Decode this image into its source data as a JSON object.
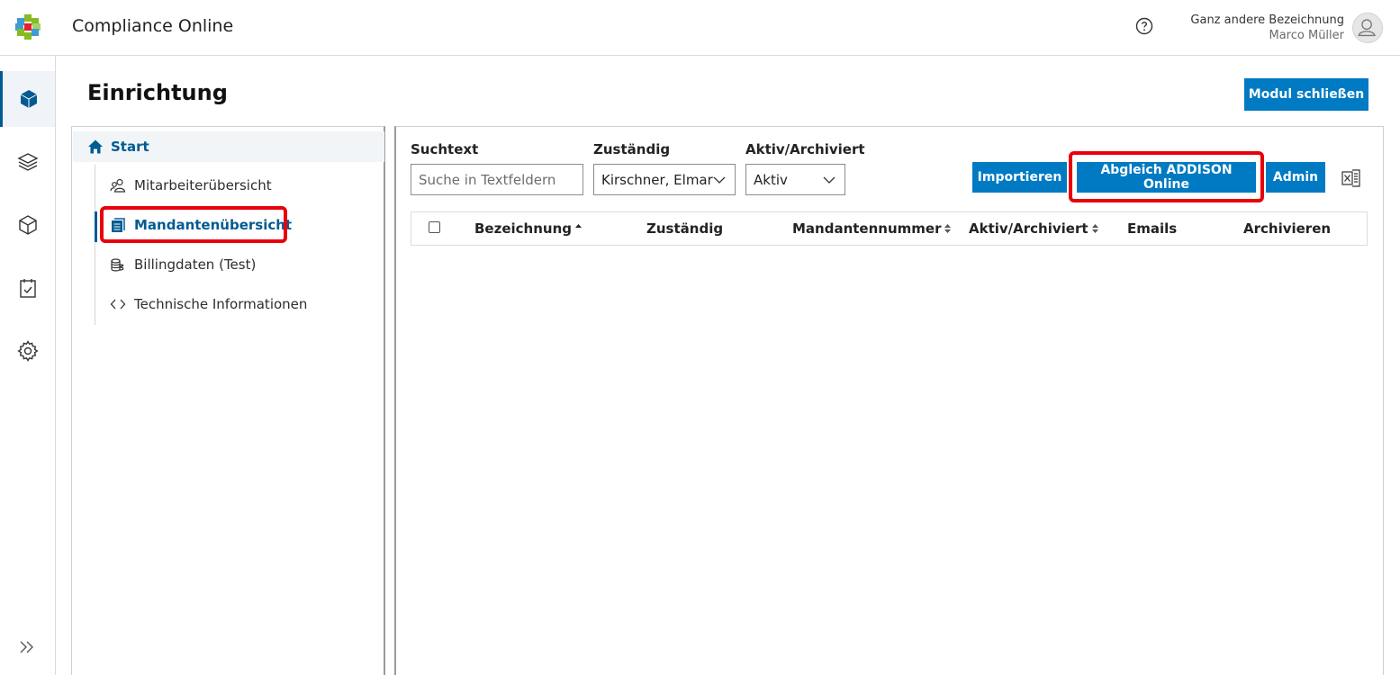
{
  "header": {
    "app_title": "Compliance Online",
    "user_org": "Ganz andere Bezeichnung",
    "user_name": "Marco Müller"
  },
  "rail": {
    "items": [
      "cube-solid-icon",
      "layers-icon",
      "box-icon",
      "clipboard-check-icon",
      "gear-icon"
    ],
    "expand_icon": "double-chevron-right-icon"
  },
  "page": {
    "title": "Einrichtung",
    "close_module_label": "Modul schließen"
  },
  "nav": {
    "start_label": "Start",
    "items": [
      {
        "label": "Mitarbeiterübersicht",
        "icon": "users-icon"
      },
      {
        "label": "Mandantenübersicht",
        "icon": "document-stack-icon",
        "selected": true
      },
      {
        "label": "Billingdaten (Test)",
        "icon": "coins-icon"
      },
      {
        "label": "Technische Informationen",
        "icon": "code-icon"
      }
    ]
  },
  "filters": {
    "search_label": "Suchtext",
    "search_placeholder": "Suche in Textfeldern",
    "responsible_label": "Zuständig",
    "responsible_value": "Kirschner, Elmar",
    "status_label": "Aktiv/Archiviert",
    "status_value": "Aktiv"
  },
  "actions": {
    "import_label": "Importieren",
    "sync_label": "Abgleich ADDISON Online",
    "admin_label": "Admin",
    "export_icon": "excel-export-icon"
  },
  "table": {
    "columns": [
      "Bezeichnung",
      "Zuständig",
      "Mandantennummer",
      "Aktiv/Archiviert",
      "Emails",
      "Archivieren"
    ],
    "rows": []
  },
  "colors": {
    "primary": "#007ac3",
    "nav_active": "#005b92",
    "highlight": "#e8000b"
  }
}
